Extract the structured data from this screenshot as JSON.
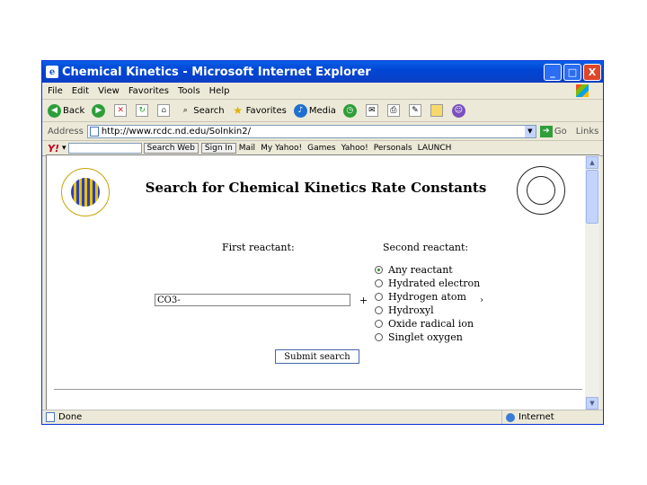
{
  "window": {
    "title": "Chemical Kinetics - Microsoft Internet Explorer",
    "app_icon": "ie-logo-icon",
    "buttons": {
      "minimize": "_",
      "maximize": "□",
      "close": "X"
    }
  },
  "menu": {
    "items": [
      "File",
      "Edit",
      "View",
      "Favorites",
      "Tools",
      "Help"
    ]
  },
  "toolbar": {
    "back": "Back",
    "forward": "",
    "search": "Search",
    "favorites": "Favorites",
    "media": "Media"
  },
  "address": {
    "label": "Address",
    "url": "http://www.rcdc.nd.edu/Solnkin2/",
    "go": "Go",
    "links": "Links"
  },
  "yahoo": {
    "logo": "Y!",
    "search_button": "Search Web",
    "signin": "Sign In",
    "items": [
      "Mail",
      "My Yahoo!",
      "Games",
      "Yahoo!",
      "Personals",
      "LAUNCH"
    ]
  },
  "page": {
    "title": "Search for Chemical Kinetics Rate Constants",
    "first_label": "First reactant:",
    "second_label": "Second reactant:",
    "first_value": "CO3-",
    "plus": "+",
    "chevron": "›",
    "options": [
      {
        "label": "Any reactant",
        "selected": true
      },
      {
        "label": "Hydrated electron",
        "selected": false
      },
      {
        "label": "Hydrogen atom",
        "selected": false
      },
      {
        "label": "Hydroxyl",
        "selected": false
      },
      {
        "label": "Oxide radical ion",
        "selected": false
      },
      {
        "label": "Singlet oxygen",
        "selected": false
      }
    ],
    "submit": "Submit search"
  },
  "status": {
    "text": "Done",
    "zone": "Internet"
  },
  "colors": {
    "titlebar": "#0046d5",
    "close": "#e0462a",
    "chrome": "#ece9d8"
  }
}
